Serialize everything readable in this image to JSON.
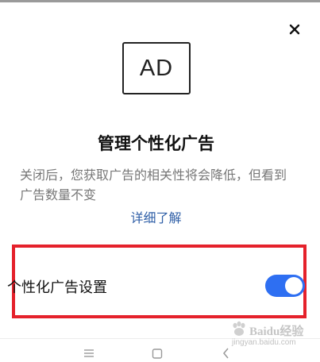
{
  "dialog": {
    "badge_text": "AD",
    "title": "管理个性化广告",
    "description": "关闭后，您获取广告的相关性将会降低，但看到广告数量不变",
    "more_link": "详细了解",
    "close_icon": "close-icon"
  },
  "setting": {
    "label": "个性化广告设置",
    "toggle_on": true
  },
  "colors": {
    "toggle_on": "#2e6ff2",
    "link": "#2f5fa7",
    "highlight_border": "#e5212b"
  },
  "nav_bar": {
    "icons": [
      "menu-icon",
      "home-icon",
      "back-icon"
    ]
  },
  "watermark": {
    "brand": "Baidu经验",
    "url": "jingyan.baidu.com"
  }
}
